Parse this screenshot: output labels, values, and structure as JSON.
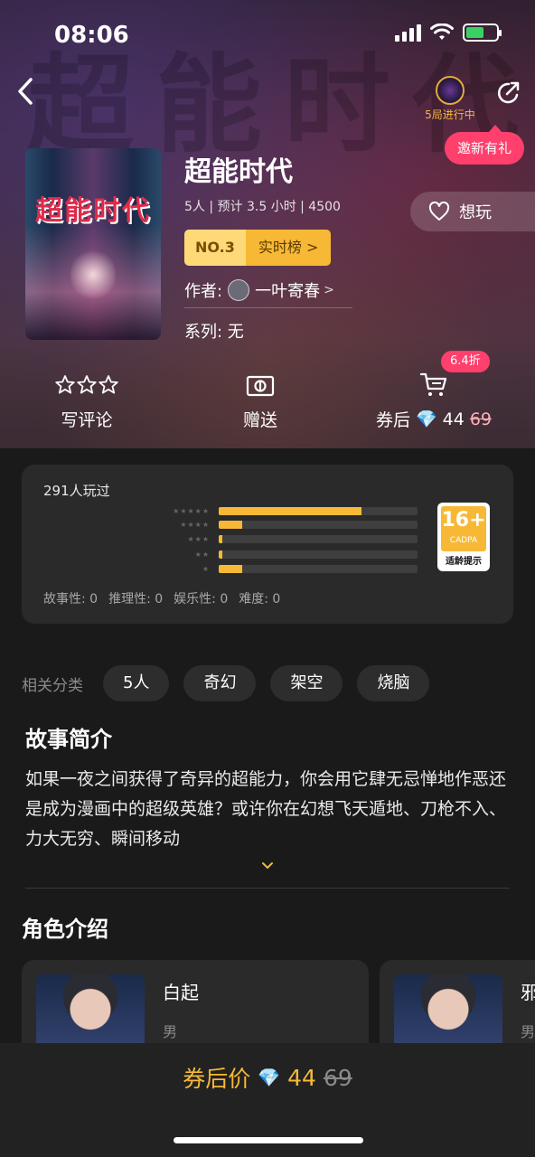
{
  "status_bar": {
    "time": "08:06"
  },
  "header": {
    "game_status": "5局进行中",
    "invite": "邀新有礼"
  },
  "cover": {
    "title": "超能时代"
  },
  "game": {
    "title": "超能时代",
    "meta": "5人 | 预计 3.5 小时 | 4500",
    "rank_no": "NO.3",
    "rank_link": "实时榜 >",
    "author_label": "作者:",
    "author_name": "一叶寄春",
    "author_arrow": ">",
    "series": "系列: 无",
    "want_label": "想玩"
  },
  "actions": {
    "review": "写评论",
    "gift": "赠送",
    "price_label": "券后",
    "price": "44",
    "old_price": "69",
    "discount": "6.4折"
  },
  "rating": {
    "played": "291人玩过",
    "star_labels": [
      "★★★★★",
      "★★★★",
      "★★★",
      "★★",
      "★"
    ],
    "distribution": [
      0.72,
      0.12,
      0.02,
      0.02,
      0.12
    ],
    "age_rating": "16+",
    "age_org": "CADPA",
    "age_tip": "适龄提示",
    "scores": [
      "故事性: 0",
      "推理性: 0",
      "娱乐性: 0",
      "难度: 0"
    ]
  },
  "tags": {
    "label": "相关分类",
    "items": [
      "5人",
      "奇幻",
      "架空",
      "烧脑"
    ]
  },
  "story": {
    "title": "故事简介",
    "text": "如果一夜之间获得了奇异的超能力，你会用它肆无忌惮地作恶还是成为漫画中的超级英雄？或许你在幻想飞天遁地、刀枪不入、力大无穷、瞬间移动"
  },
  "characters": {
    "title": "角色介绍",
    "items": [
      {
        "name": "白起",
        "gender": "男"
      },
      {
        "name": "邪",
        "gender": "男"
      }
    ]
  },
  "bottom": {
    "label": "券后价",
    "price": "44",
    "old_price": "69"
  },
  "colors": {
    "accent": "#f7b935",
    "pink": "#ff3f6c",
    "bg": "#1a1a1a"
  }
}
